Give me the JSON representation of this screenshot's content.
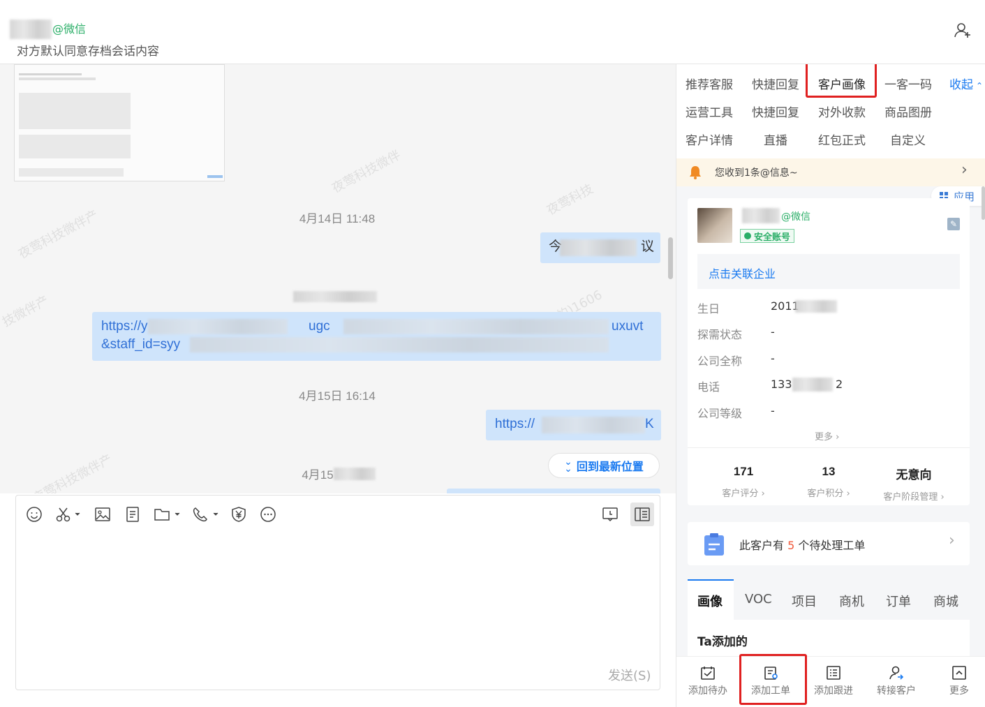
{
  "header": {
    "contact_suffix": "@微信",
    "consent_note": "对方默认同意存档会话内容"
  },
  "chat": {
    "time1": "4月14日 11:48",
    "msg1_start": "今",
    "msg1_end": "议",
    "link1_line1_start": "https://y",
    "link1_line1_mid": "ugc",
    "link1_line1_end": "uxuvt",
    "link1_line2_start": "&staff_id=syy",
    "time2": "4月15日 16:14",
    "link2_start": "https://",
    "link2_end": "K",
    "time3_partial": "4月15",
    "back_to_latest": "回到最新位置"
  },
  "composer": {
    "send_label": "发送(S)"
  },
  "right_panel": {
    "tabs_row1": [
      "推荐客服",
      "快捷回复",
      "客户画像",
      "一客一码"
    ],
    "collapse_label": "收起",
    "tabs_row2": [
      "运营工具",
      "快捷回复",
      "对外收款",
      "商品图册"
    ],
    "tabs_row3": [
      "客户详情",
      "直播",
      "红包正式",
      "自定义"
    ],
    "notice_text": "您收到1条@信息~",
    "apps_label": "应用",
    "profile": {
      "suffix": "@微信",
      "safe_badge": "安全账号",
      "link_company": "点击关联企业",
      "fields": [
        {
          "label": "生日",
          "value": "2011"
        },
        {
          "label": "探需状态",
          "value": "-"
        },
        {
          "label": "公司全称",
          "value": "-"
        },
        {
          "label": "电话",
          "value": "133",
          "value_tail": "2"
        },
        {
          "label": "公司等级",
          "value": "-"
        }
      ],
      "more": "更多"
    },
    "stats": [
      {
        "value": "171",
        "label": "客户评分"
      },
      {
        "value": "13",
        "label": "客户积分"
      },
      {
        "value": "无意向",
        "label": "客户阶段管理"
      }
    ],
    "workorder": {
      "prefix": "此客户有",
      "count": "5",
      "suffix": "个待处理工单"
    },
    "portrait_tabs": [
      "画像",
      "VOC",
      "项目",
      "商机",
      "订单",
      "商城"
    ],
    "ta_added": "Ta添加的",
    "actions": [
      "添加待办",
      "添加工单",
      "添加跟进",
      "转接客户",
      "更多"
    ]
  },
  "colors": {
    "accent": "#1a7af0",
    "bubble": "#cfe4fb",
    "highlight_box": "#e02020",
    "wechat_green": "#2aae67"
  }
}
